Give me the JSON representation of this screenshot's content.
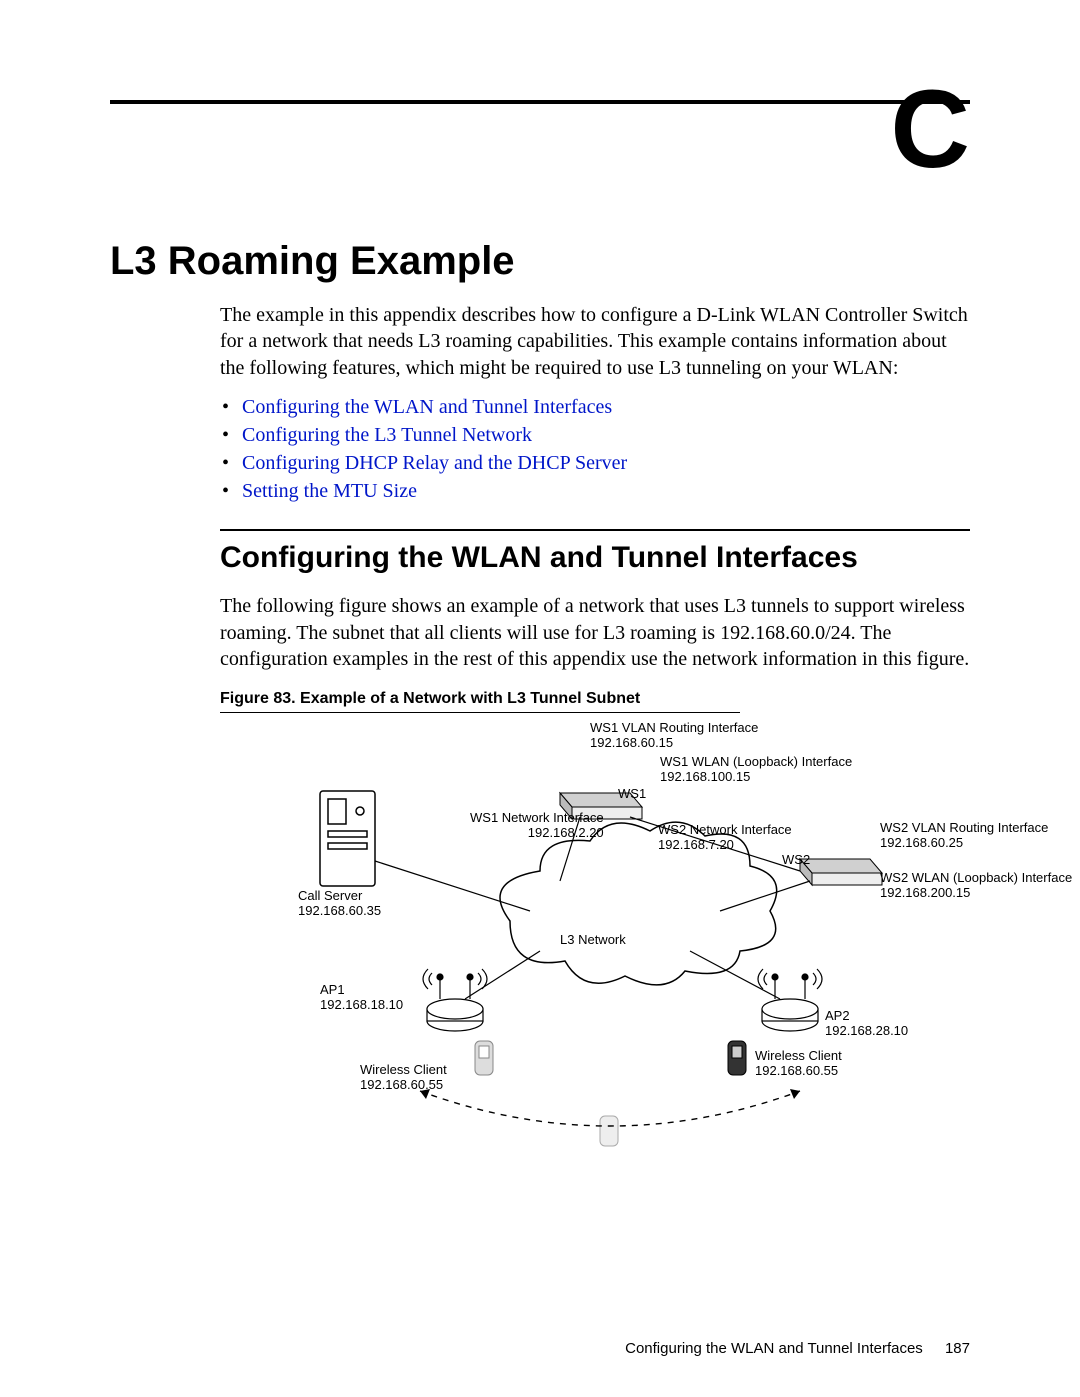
{
  "appendix_letter": "C",
  "title": "L3 Roaming Example",
  "intro": "The example in this appendix describes how to configure a D-Link WLAN Controller Switch for a network that needs L3 roaming capabilities. This example contains information about the following features, which might be required to use L3 tunneling on your WLAN:",
  "links": [
    "Configuring the WLAN and Tunnel Interfaces",
    "Configuring the L3 Tunnel Network",
    "Configuring DHCP Relay and the DHCP Server",
    "Setting the MTU Size"
  ],
  "section_heading": "Configuring the WLAN and Tunnel Interfaces",
  "section_body": "The following figure shows an example of a network that uses L3 tunnels to support wireless roaming. The subnet that all clients will use for L3 roaming is 192.168.60.0/24. The configuration examples in the rest of this appendix use the network information in this figure.",
  "figure_caption": "Figure 83.  Example of a Network with L3 Tunnel Subnet",
  "diagram": {
    "ws1_vlan_label": "WS1 VLAN Routing Interface",
    "ws1_vlan_ip": "192.168.60.15",
    "ws1_loop_label": "WS1 WLAN (Loopback) Interface",
    "ws1_loop_ip": "192.168.100.15",
    "ws1_box": "WS1",
    "ws1_net_label": "WS1 Network Interface",
    "ws1_net_ip": "192.168.2.20",
    "ws2_net_label": "WS2 Network Interface",
    "ws2_net_ip": "192.168.7.20",
    "ws2_box": "WS2",
    "ws2_vlan_label": "WS2 VLAN Routing Interface",
    "ws2_vlan_ip": "192.168.60.25",
    "ws2_loop_label": "WS2 WLAN (Loopback) Interface",
    "ws2_loop_ip": "192.168.200.15",
    "call_server_label": "Call Server",
    "call_server_ip": "192.168.60.35",
    "l3_label": "L3 Network",
    "ap1_label": "AP1",
    "ap1_ip": "192.168.18.10",
    "ap2_label": "AP2",
    "ap2_ip": "192.168.28.10",
    "wc1_label": "Wireless Client",
    "wc1_ip": "192.168.60.55",
    "wc2_label": "Wireless Client",
    "wc2_ip": "192.168.60.55"
  },
  "footer_title": "Configuring the WLAN and Tunnel Interfaces",
  "footer_page": "187"
}
